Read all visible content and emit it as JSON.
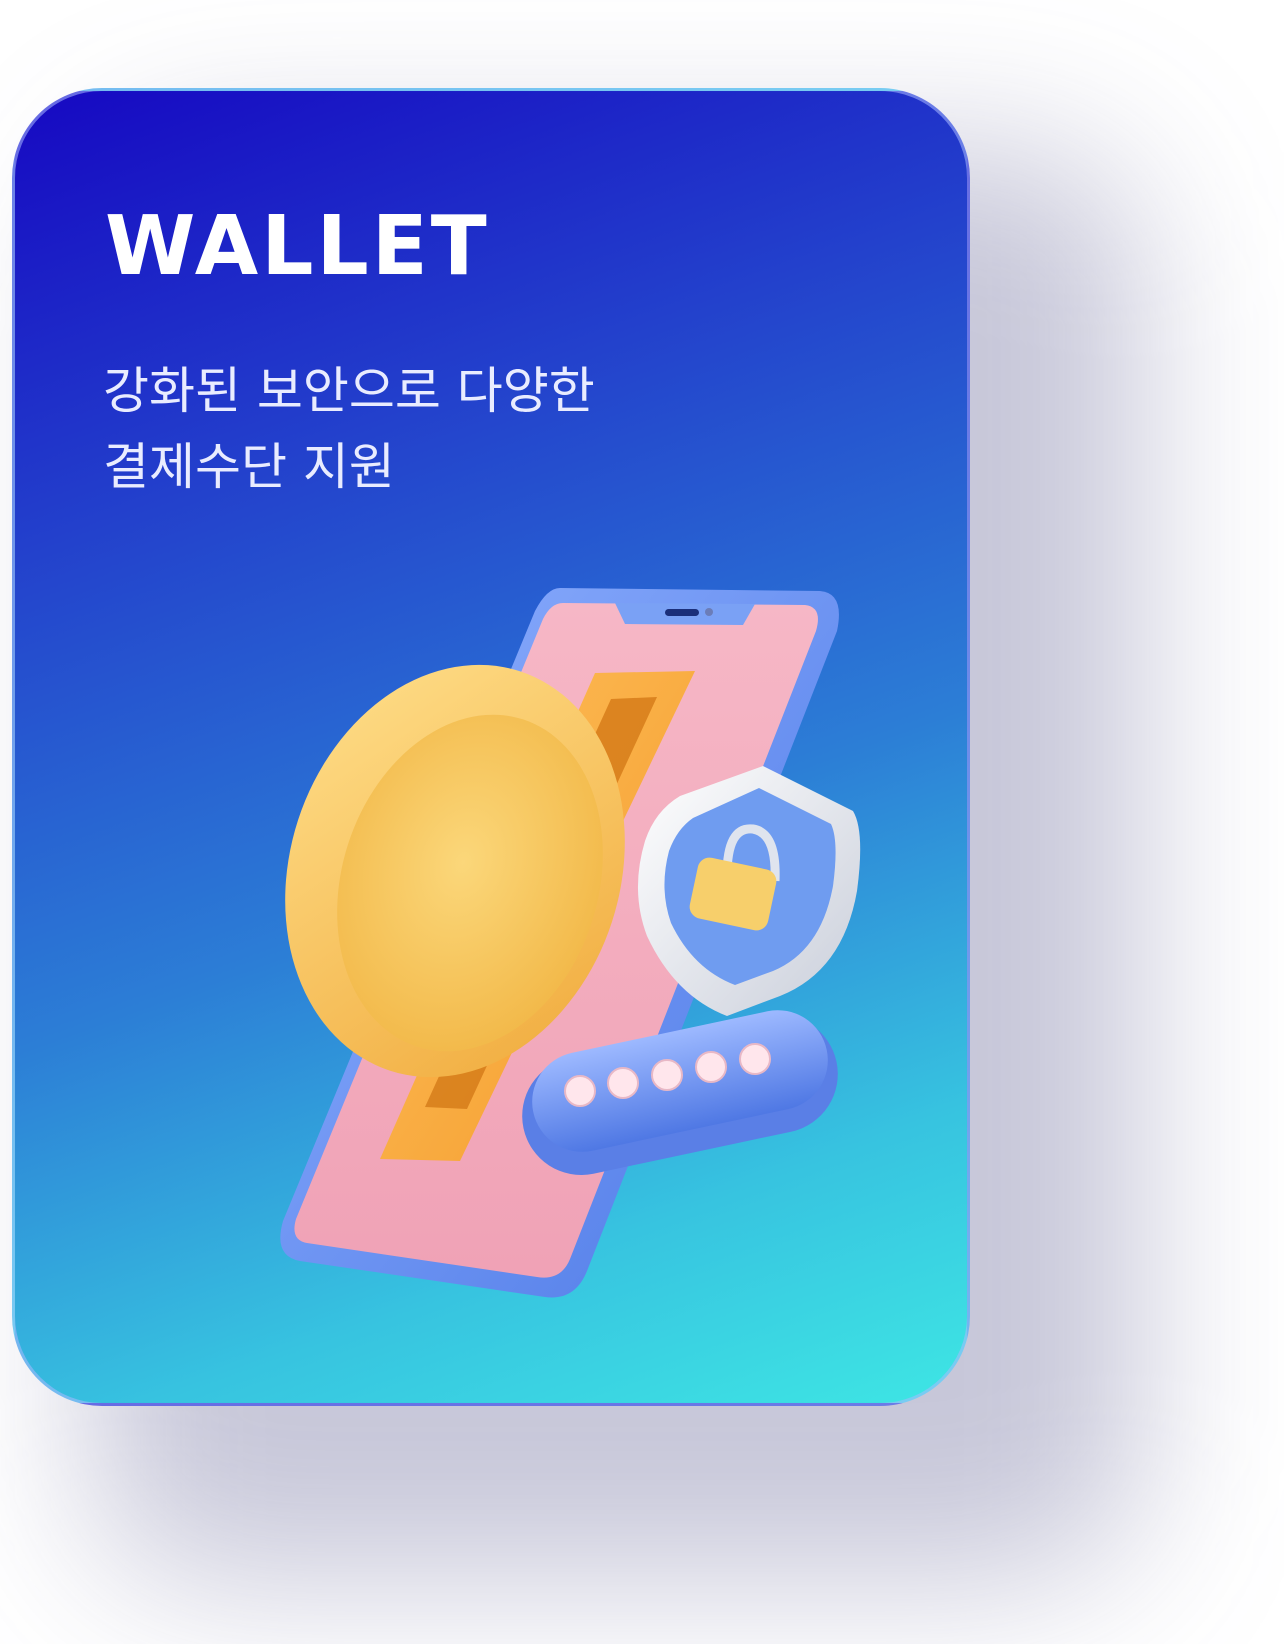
{
  "card": {
    "title": "WALLET",
    "subtitle_lines": [
      "강화된 보안으로 다양한",
      "결제수단 지원"
    ]
  },
  "illustration": {
    "icons": [
      "phone-icon",
      "coin-icon",
      "shield-lock-icon",
      "password-field-icon"
    ],
    "password_mask": "*****"
  },
  "colors": {
    "gradient_start": "#1608c2",
    "gradient_end": "#3ee6e4",
    "phone_screen": "#f4a9bd",
    "coin": "#f7c55a",
    "shield": "#6f9cf0"
  }
}
